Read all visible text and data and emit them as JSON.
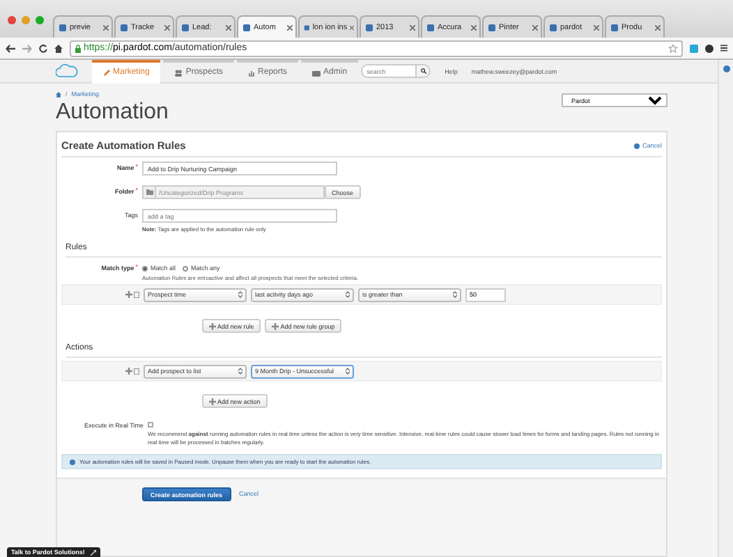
{
  "browser": {
    "tabs": [
      {
        "label": "previe",
        "selected": false
      },
      {
        "label": "Tracke",
        "selected": false
      },
      {
        "label": "Lead:",
        "selected": false
      },
      {
        "label": "Autom",
        "selected": true
      },
      {
        "label": "lon ion ins",
        "selected": false
      },
      {
        "label": "2013",
        "selected": false
      },
      {
        "label": "Accura",
        "selected": false
      },
      {
        "label": "Pinter",
        "selected": false
      },
      {
        "label": "pardot",
        "selected": false
      },
      {
        "label": "Produ",
        "selected": false
      }
    ],
    "url": {
      "scheme": "https://",
      "host": "pi.pardot.com",
      "path": "/automation/rules"
    }
  },
  "nav": {
    "items": [
      {
        "label": "Marketing",
        "selected": true
      },
      {
        "label": "Prospects",
        "selected": false
      },
      {
        "label": "Reports",
        "selected": false
      },
      {
        "label": "Admin",
        "selected": false
      }
    ],
    "search_placeholder": "search",
    "help": "Help",
    "user": "mathew.sweezey@pardot.com"
  },
  "breadcrumb_separator": "/",
  "breadcrumb": "Marketing",
  "page_title": "Automation",
  "account": "Pardot",
  "form": {
    "title": "Create Automation Rules",
    "cancel": "Cancel",
    "name": {
      "label": "Name",
      "required_mark": "*",
      "value": "Add to Drip Nurturing Campaign"
    },
    "folder": {
      "label": "Folder",
      "required_mark": "*",
      "value": "/Uncategorized/Drip Programs",
      "button": "Choose"
    },
    "tags": {
      "label": "Tags",
      "placeholder": "add a tag",
      "note": "**Note:** Tags are applied to the automation rule only"
    },
    "rules_heading": "Rules",
    "match_type": {
      "label": "Match type",
      "required_mark": "*",
      "options": [
        {
          "label": "Match all",
          "selected": true
        },
        {
          "label": "Match any",
          "selected": false
        }
      ],
      "help": "Automation Rules are retroactive and affect all prospects that meet the selected criteria."
    },
    "rule": {
      "field": "Prospect time",
      "operand": "last activity days ago",
      "operator": "is greater than",
      "value": "50"
    },
    "rule_buttons": [
      "Add new rule",
      "Add new rule group"
    ],
    "actions_heading": "Actions",
    "action": {
      "type": "Add prospect to list",
      "list": "9 Month Drip - Unsuccessful"
    },
    "action_button": "Add new action",
    "real_time": {
      "label": "Execute in Real Time",
      "checked": false,
      "text": "We recommend **against** running automation rules in real time unless the action is very time sensitive. Intensive, real-time rules could cause slower load times for forms and landing pages. Rules not running in real time will be processed in batches regularly."
    },
    "info": "Your automation rules will be saved in Paused mode. Unpause them when you are ready to start the automation rules.",
    "submit": "Create automation rules",
    "footer_cancel": "Cancel"
  },
  "chat": "Talk to Pardot Solutions!"
}
